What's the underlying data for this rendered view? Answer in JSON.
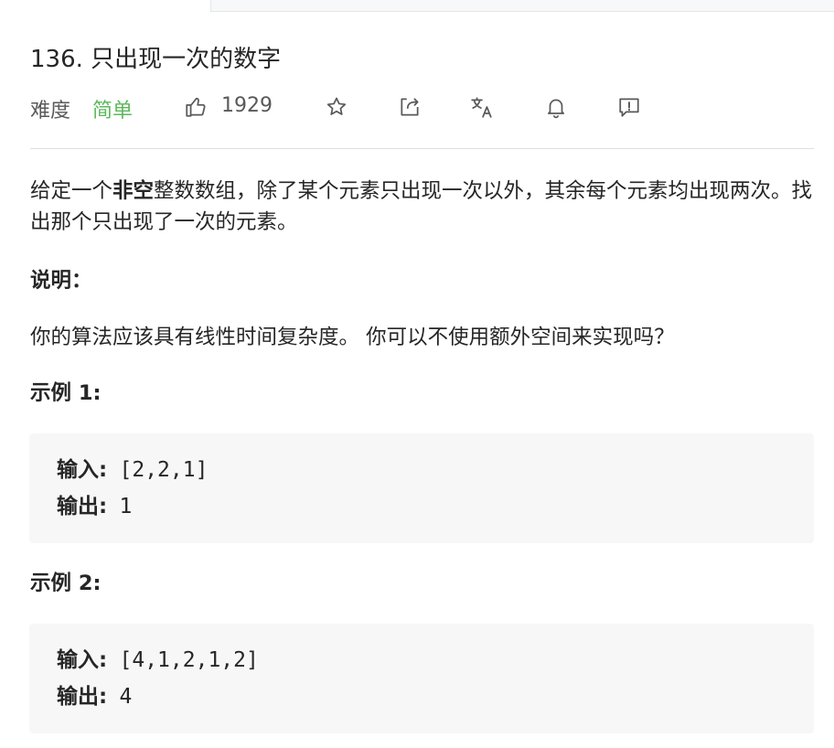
{
  "problem": {
    "title": "136. 只出现一次的数字",
    "difficulty_label": "难度",
    "difficulty_value": "简单",
    "likes": "1929"
  },
  "toolbar": {
    "icons": [
      "thumbs-up-icon",
      "star-icon",
      "share-icon",
      "translate-icon",
      "bell-icon",
      "feedback-icon"
    ]
  },
  "description": {
    "text_before": "给定一个",
    "bold": "非空",
    "text_after": "整数数组，除了某个元素只出现一次以外，其余每个元素均出现两次。找出那个只出现了一次的元素。"
  },
  "note": {
    "title": "说明：",
    "body": "你的算法应该具有线性时间复杂度。 你可以不使用额外空间来实现吗？"
  },
  "examples": [
    {
      "title": "示例 1:",
      "input_label": "输入:",
      "input_value": "[2,2,1]",
      "output_label": "输出:",
      "output_value": "1"
    },
    {
      "title": "示例 2:",
      "input_label": "输入:",
      "input_value": "[4,1,2,1,2]",
      "output_label": "输出:",
      "output_value": "4"
    }
  ],
  "colors": {
    "easy": "#5cb85c",
    "text": "#262626",
    "muted": "#595959",
    "code_bg": "#f7f7f8"
  }
}
